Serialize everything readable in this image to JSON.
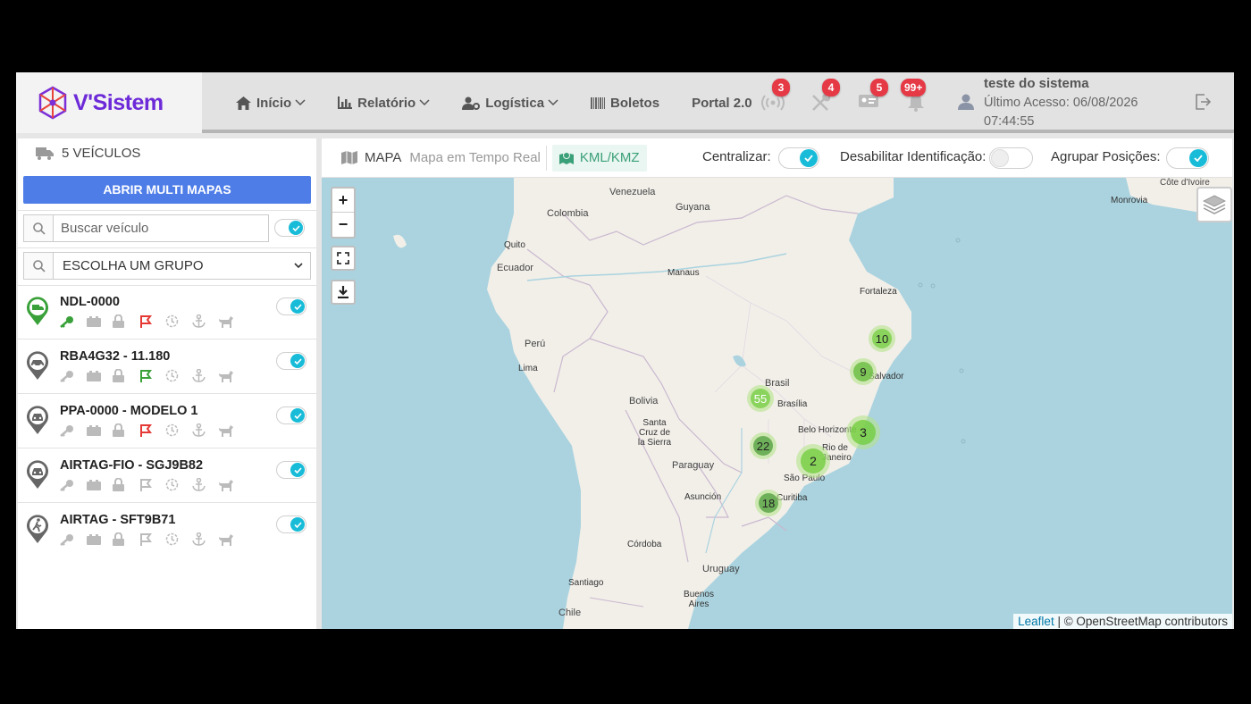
{
  "header": {
    "logo_text": "V'Sistem",
    "nav": [
      {
        "label": "Início",
        "icon": "home-icon",
        "dropdown": true
      },
      {
        "label": "Relatório",
        "icon": "bar-chart-icon",
        "dropdown": true
      },
      {
        "label": "Logística",
        "icon": "users-gear-icon",
        "dropdown": true
      },
      {
        "label": "Boletos",
        "icon": "barcode-icon",
        "dropdown": false
      },
      {
        "label": "Portal 2.0",
        "icon": "",
        "dropdown": false
      }
    ],
    "notifications": [
      {
        "icon": "signal-tower-icon",
        "count": "3"
      },
      {
        "icon": "tools-icon",
        "count": "4"
      },
      {
        "icon": "id-card-icon",
        "count": "5"
      },
      {
        "icon": "bell-icon",
        "count": "99+"
      }
    ],
    "user": {
      "name": "teste do sistema",
      "last_access": "Último Acesso: 06/08/2026",
      "time": "07:44:55"
    }
  },
  "sidebar": {
    "title": "5 VEÍCULOS",
    "multi_maps_button": "ABRIR MULTI MAPAS",
    "search_placeholder": "Buscar veículo",
    "group_select": "ESCOLHA UM GRUPO",
    "vehicles": [
      {
        "name": "NDL-0000",
        "pin_color": "#3aa13a",
        "pin_icon": "truck-icon",
        "key_on": true,
        "flag_color": "#e53935",
        "enabled": true
      },
      {
        "name": "RBA4G32 - 11.180",
        "pin_color": "#666666",
        "pin_icon": "car-icon",
        "key_on": false,
        "flag_color": "#3aa13a",
        "enabled": true
      },
      {
        "name": "PPA-0000 - MODELO 1",
        "pin_color": "#666666",
        "pin_icon": "car-icon",
        "key_on": false,
        "flag_color": "#e53935",
        "enabled": true
      },
      {
        "name": "AIRTAG-FIO - SGJ9B82",
        "pin_color": "#666666",
        "pin_icon": "car-icon",
        "key_on": false,
        "flag_color": "#b8b8b8",
        "enabled": true
      },
      {
        "name": "AIRTAG - SFT9B71",
        "pin_color": "#666666",
        "pin_icon": "walker-icon",
        "key_on": false,
        "flag_color": "#b8b8b8",
        "enabled": true
      }
    ]
  },
  "map_panel": {
    "tab_map": "MAPA",
    "tab_map_sub": "Mapa em Tempo Real",
    "tab_kml": "KML/KMZ",
    "centralize_label": "Centralizar:",
    "disable_ident_label": "Desabilitar Identificação:",
    "group_positions_label": "Agrupar Posições:",
    "zoom_in": "+",
    "zoom_out": "−",
    "attribution_link": "Leaflet",
    "attribution_text": " | © OpenStreetMap contributors"
  },
  "map": {
    "labels": {
      "venezuela": "Venezuela",
      "colombia": "Colombia",
      "guyana": "Guyana",
      "quito": "Quito",
      "ecuador": "Ecuador",
      "manaus": "Manaus",
      "fortaleza": "Fortaleza",
      "peru": "Perú",
      "lima": "Lima",
      "brasil": "Brasil",
      "brasilia": "Brasília",
      "bolivia": "Bolivia",
      "santa_cruz": "Santa Cruz de la Sierra",
      "belo": "Belo Horizonte",
      "rio": "Rio de Janeiro",
      "salvador": "Salvador",
      "paraguay": "Paraguay",
      "sao_paulo": "São Paulo",
      "asuncion": "Asunción",
      "curitiba": "Curitiba",
      "cordoba": "Córdoba",
      "uruguay": "Uruguay",
      "santiago": "Santiago",
      "buenos_aires": "Buenos Aires",
      "chile": "Chile",
      "cote": "Côte d'Ivoire",
      "monrovia": "Monrovia"
    },
    "clusters": [
      "10",
      "9",
      "55",
      "3",
      "22",
      "2",
      "18"
    ]
  }
}
